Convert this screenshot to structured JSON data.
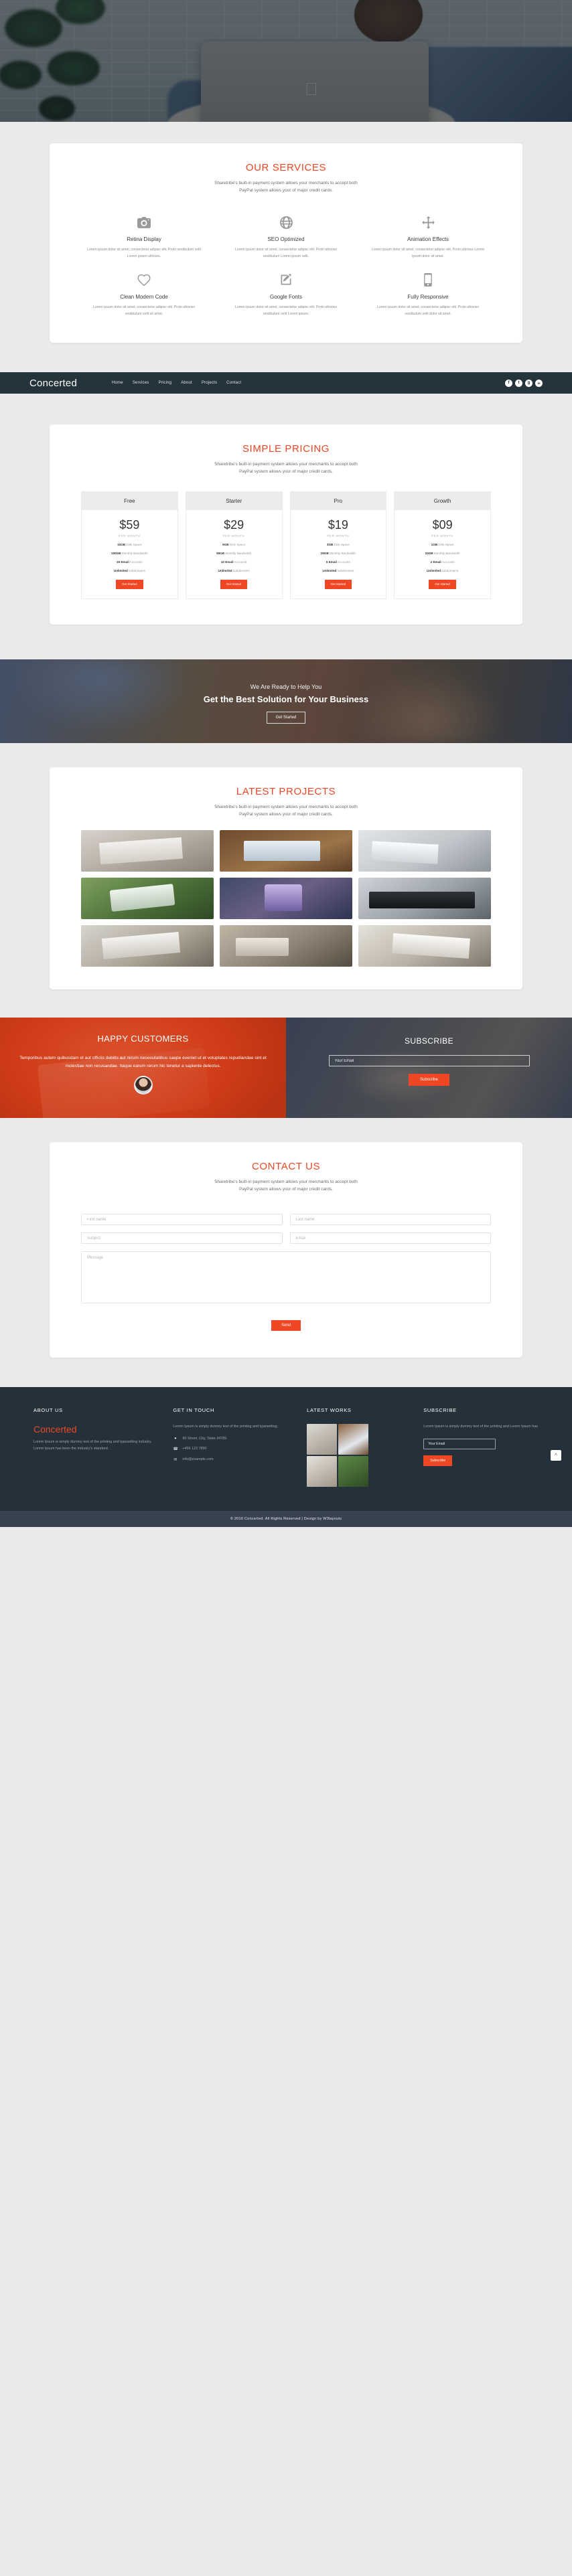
{
  "theme": {
    "accent": "#ef4623",
    "dark": "#25333c",
    "band": "#eaeaea",
    "copy_bar": "#38414f"
  },
  "hero": {
    "alt": "woman-with-laptop-hero-photo"
  },
  "services": {
    "title": "OUR SERVICES",
    "subtitle_line1": "Sharetribe's built-in payment system allows your merchants to accept both",
    "subtitle_line2": "PayPal system allows your of major credit cards.",
    "items": [
      {
        "icon": "camera-icon",
        "title": "Retina Display",
        "text": "Lorem ipsum dolor sit amet, consectetur adipisc elit. Proin vestibulum velit Lorem ipsum ultricies."
      },
      {
        "icon": "globe-icon",
        "title": "SEO Optimized",
        "text": "Lorem ipsum dolor sit amet, consectetur adipisc elit. Proin ultricies vestibulum Lorem ipsum velit."
      },
      {
        "icon": "arrows-move-icon",
        "title": "Animation Effects",
        "text": "Lorem ipsum dolor sit amet, consectetur adipisc elit. Proin ultricies Lorem ipsum dolor sit amet."
      },
      {
        "icon": "heart-icon",
        "title": "Clean Modern Code",
        "text": "Lorem ipsum dolor sit amet, consectetur adipisc elit. Proin ultricies vestibulum velit sit amet."
      },
      {
        "icon": "edit-square-icon",
        "title": "Google Fonts",
        "text": "Lorem ipsum dolor sit amet, consectetur adipisc elit. Proin ultricies vestibulum velit Lorem ipsum."
      },
      {
        "icon": "mobile-phone-icon",
        "title": "Fully Responsive",
        "text": "Lorem ipsum dolor sit amet, consectetur adipisc elit. Proin ultricies vestibulum velit dolor sit amet."
      }
    ]
  },
  "navbar": {
    "brand": "Concerted",
    "links": [
      "Home",
      "Services",
      "Pricing",
      "About",
      "Projects",
      "Contact"
    ],
    "socials": [
      {
        "name": "facebook-icon",
        "glyph": "f"
      },
      {
        "name": "twitter-icon",
        "glyph": "t"
      },
      {
        "name": "google-plus-icon",
        "glyph": "g"
      },
      {
        "name": "linkedin-icon",
        "glyph": "in"
      }
    ]
  },
  "pricing": {
    "title": "SIMPLE PRICING",
    "subtitle_line1": "Sharetribe's built-in payment system allows your merchants to accept both",
    "subtitle_line2": "PayPal system allows your of major credit cards.",
    "scroll_top_icon": "chevron-up-icon",
    "plans": [
      {
        "name": "Free",
        "price": "$59",
        "per": "PER MONTH",
        "features": [
          {
            "value": "10GB",
            "label": "Disk Space"
          },
          {
            "value": "100GB",
            "label": "Monthly Bandwidth"
          },
          {
            "value": "20 Email",
            "label": "Accounts"
          },
          {
            "value": "Unlimited",
            "label": "subdomains"
          }
        ],
        "cta": "Get Started"
      },
      {
        "name": "Starter",
        "price": "$29",
        "per": "PER MONTH",
        "features": [
          {
            "value": "5GB",
            "label": "Disk Space"
          },
          {
            "value": "50GB",
            "label": "Monthly Bandwidth"
          },
          {
            "value": "10 Email",
            "label": "Accounts"
          },
          {
            "value": "Unlimited",
            "label": "subdomains"
          }
        ],
        "cta": "Get Started"
      },
      {
        "name": "Pro",
        "price": "$19",
        "per": "PER MONTH",
        "features": [
          {
            "value": "3GB",
            "label": "Disk Space"
          },
          {
            "value": "25GB",
            "label": "Monthly Bandwidth"
          },
          {
            "value": "5 Email",
            "label": "Accounts"
          },
          {
            "value": "Unlimited",
            "label": "subdomains"
          }
        ],
        "cta": "Get Started"
      },
      {
        "name": "Growth",
        "price": "$09",
        "per": "PER MONTH",
        "features": [
          {
            "value": "1GB",
            "label": "Disk Space"
          },
          {
            "value": "10GB",
            "label": "Monthly Bandwidth"
          },
          {
            "value": "2 Email",
            "label": "Accounts"
          },
          {
            "value": "Unlimited",
            "label": "subdomains"
          }
        ],
        "cta": "Get Started"
      }
    ]
  },
  "cta": {
    "subtitle": "We Are Ready to Help You",
    "title": "Get the Best Solution for Your Business",
    "button": "Get Started"
  },
  "projects": {
    "title": "LATEST PROJECTS",
    "subtitle_line1": "Sharetribe's built-in payment system allows your merchants to accept both",
    "subtitle_line2": "PayPal system allows your of major credit cards.",
    "thumbs": [
      "desk-with-notebook-and-coffee",
      "laptop-on-wooden-desk-with-website",
      "hands-typing-on-laptop-keyboard",
      "tablet-over-green-field",
      "purple-smartphone-in-hand",
      "black-keyboard-close-up",
      "person-typing-laptop-at-desk",
      "notebook-and-pen-on-table",
      "laptop-showing-dashboard"
    ]
  },
  "testimonial": {
    "title": "HAPPY CUSTOMERS",
    "text": "Temporibus autem quibusdam et aut officiis debitis aut rerum necessitatibus saepe eveniet ut et voluptates repudiandae sint et molestiae non recusandae. Itaque earum rerum hic tenetur a sapiente delectus.",
    "avatar": "customer-avatar"
  },
  "subscribe": {
    "title": "SUBSCRIBE",
    "placeholder": "Your Email",
    "button": "Subscribe"
  },
  "contact": {
    "title": "CONTACT US",
    "subtitle_line1": "Sharetribe's built-in payment system allows your merchants to accept both",
    "subtitle_line2": "PayPal system allows your of major credit cards.",
    "first_name_placeholder": "First name",
    "last_name_placeholder": "Last name",
    "subject_placeholder": "Subject",
    "email_placeholder": "Email",
    "message_placeholder": "Message",
    "send_button": "Send"
  },
  "footer": {
    "about": {
      "heading": "ABOUT US",
      "brand": "Concerted",
      "text": "Lorem Ipsum is simply dummy text of the printing and typesetting industry. Lorem Ipsum has been the industry's standard."
    },
    "touch": {
      "heading": "GET IN TOUCH",
      "text": "Lorem Ipsum is simply dummy text of the printing and typesetting.",
      "address": "90 Street, City, State 34789.",
      "phone": "+456 123 7890",
      "email": "info@example.com",
      "address_icon": "map-pin-icon",
      "phone_icon": "phone-icon",
      "email_icon": "envelope-icon"
    },
    "works": {
      "heading": "LATEST WORKS",
      "thumbs": [
        "desk-meeting-photo",
        "laptop-website-photo",
        "laptop-with-mug-photo",
        "tablet-in-stadium-photo"
      ]
    },
    "subscribe": {
      "heading": "SUBSCRIBE",
      "text": "Lorem Ipsum is simply dummy text of the printing and Lorem Ipsum has",
      "placeholder": "Your Email",
      "button": "Subscribe"
    },
    "copyright": "© 2016 Concerted. All Rights Reserved | Design by W3layouts"
  }
}
